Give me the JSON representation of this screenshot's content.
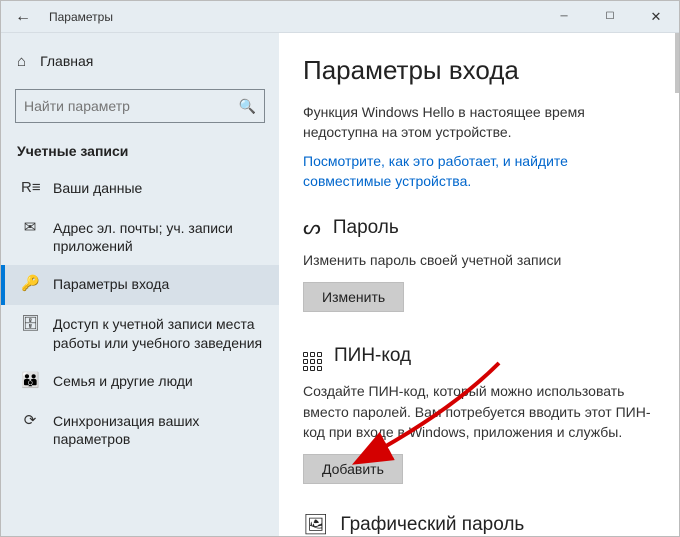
{
  "titlebar": {
    "app_title": "Параметры"
  },
  "home": {
    "label": "Главная"
  },
  "search": {
    "placeholder": "Найти параметр"
  },
  "section_header": "Учетные записи",
  "nav": [
    {
      "icon": "R≡",
      "label": "Ваши данные"
    },
    {
      "icon": "✉",
      "label": "Адрес эл. почты; уч. записи приложений"
    },
    {
      "icon": "🔑",
      "label": "Параметры входа"
    },
    {
      "icon": "🗄",
      "label": "Доступ к учетной записи места работы или учебного заведения"
    },
    {
      "icon": "👪",
      "label": "Семья и другие люди"
    },
    {
      "icon": "⟳",
      "label": "Синхронизация ваших параметров"
    }
  ],
  "content": {
    "page_title": "Параметры входа",
    "hello_desc": "Функция Windows Hello в настоящее время недоступна на этом устройстве.",
    "hello_link": "Посмотрите, как это работает, и найдите совместимые устройства.",
    "password": {
      "title": "Пароль",
      "desc": "Изменить пароль своей учетной записи",
      "button": "Изменить"
    },
    "pin": {
      "title": "ПИН-код",
      "desc": "Создайте ПИН-код, который можно использовать вместо паролей. Вам потребуется вводить этот ПИН-код при входе в Windows, приложения и службы.",
      "button": "Добавить"
    },
    "picture": {
      "title": "Графический пароль"
    }
  }
}
